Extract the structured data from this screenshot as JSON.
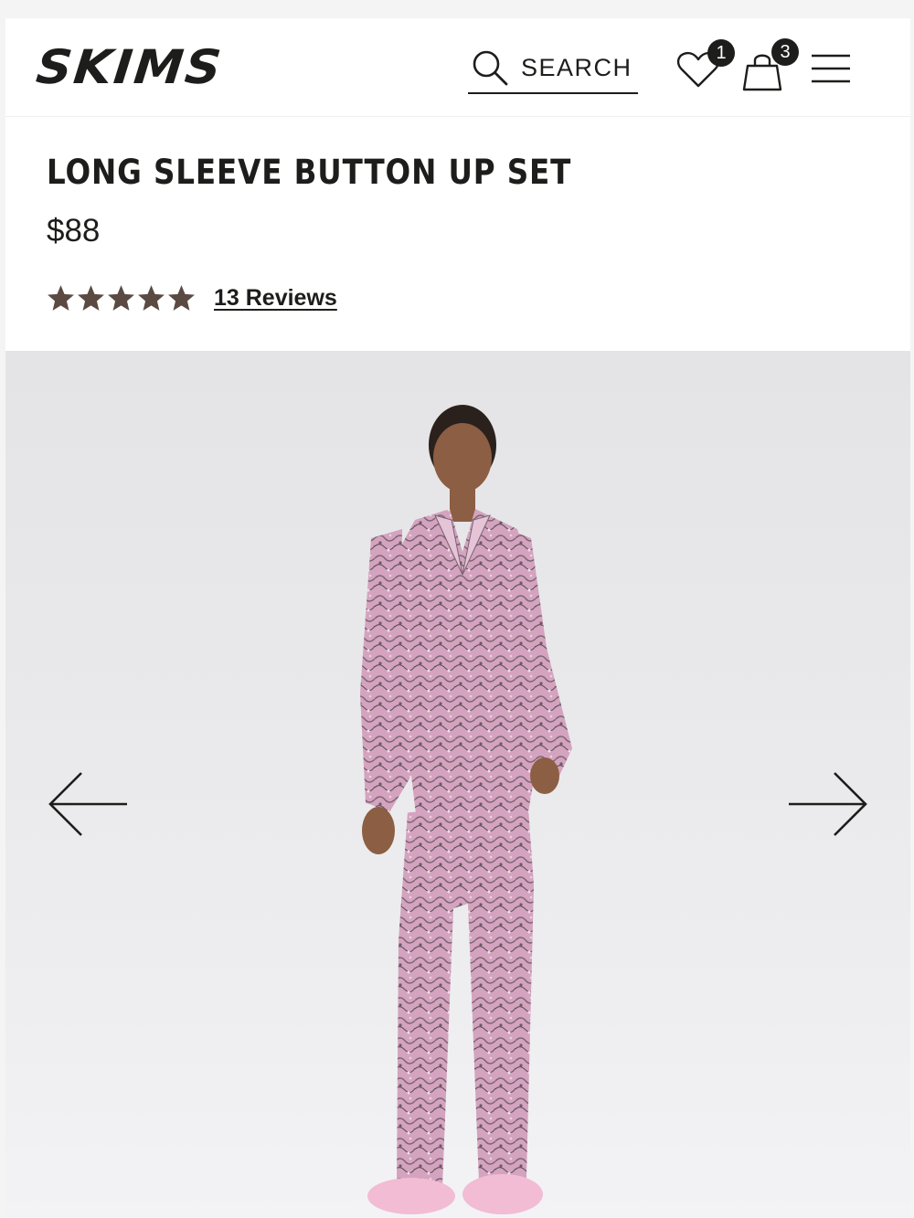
{
  "header": {
    "logo": "SKIMS",
    "search_label": "SEARCH",
    "wishlist_count": "1",
    "bag_count": "3"
  },
  "product": {
    "title": "LONG SLEEVE BUTTON UP SET",
    "price": "$88",
    "rating": 5,
    "reviews_label": "13 Reviews"
  },
  "gallery": {
    "prev_icon": "arrow-left-icon",
    "next_icon": "arrow-right-icon",
    "image_subject": "model wearing pink animal print pajama set"
  },
  "colors": {
    "text": "#1d1d1b",
    "star": "#5a4a42",
    "background": "#ffffff",
    "gallery_bg": "#e9e9eb",
    "pajama_pink": "#d9a6c4"
  }
}
